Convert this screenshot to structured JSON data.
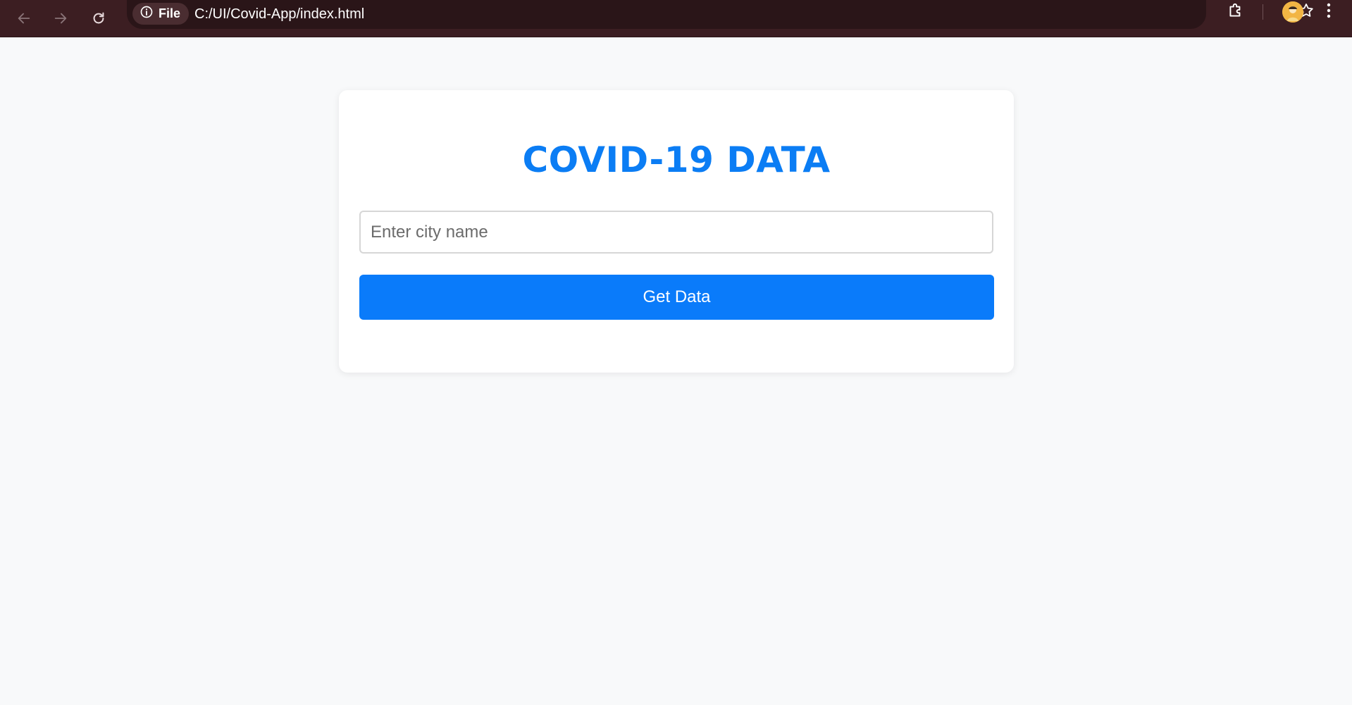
{
  "browser": {
    "site_chip_label": "File",
    "url": "C:/UI/Covid-App/index.html",
    "colors": {
      "toolbar": "#3c1e22",
      "omnibox": "#2a1518"
    }
  },
  "page": {
    "title": "COVID-19 DATA",
    "city_input": {
      "placeholder": "Enter city name",
      "value": ""
    },
    "get_data_label": "Get Data",
    "colors": {
      "accent": "#0a7bfa",
      "title": "#0b7df4",
      "background": "#f8f9fa"
    }
  },
  "icons": {
    "back": "arrow-left-icon",
    "forward": "arrow-right-icon",
    "reload": "reload-icon",
    "site_info": "info-icon",
    "bookmark": "star-icon",
    "extensions": "puzzle-icon",
    "menu": "kebab-menu-icon"
  }
}
